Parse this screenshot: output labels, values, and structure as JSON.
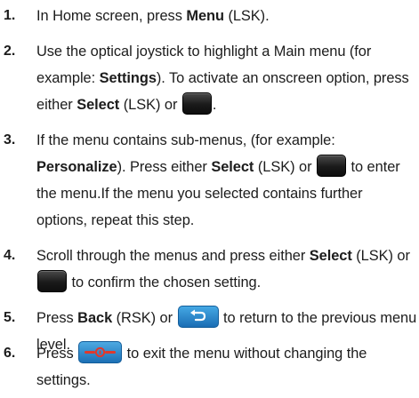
{
  "steps": [
    {
      "number": "1.",
      "lines": [
        {
          "t1": "In Home screen, press ",
          "b1": "Menu",
          "t2": " (LSK)."
        }
      ]
    },
    {
      "number": "2.",
      "lines": [
        {
          "t1": "Use the optical joystick to highlight a Main menu (for"
        },
        {
          "t1": "example: ",
          "b1": "Settings",
          "t2": "). To activate an onscreen option, press"
        },
        {
          "t1": "either ",
          "b1": "Select",
          "t2": " (LSK) or ",
          "key": "ok-key-dark",
          "t3": "."
        }
      ]
    },
    {
      "number": "3.",
      "lines": [
        {
          "t1": "If the menu contains sub-menus, (for example:"
        },
        {
          "b1": "Personalize",
          "t1": "). Press either ",
          "b2": "Select",
          "t2": " (LSK) or ",
          "key": "ok-key-dark",
          "t3": " to enter"
        },
        {
          "t1": "the menu.If the menu you selected contains further"
        },
        {
          "t1": "options, repeat this step."
        }
      ]
    },
    {
      "number": "4.",
      "lines": [
        {
          "t1": "Scroll through the menus and press either ",
          "b1": "Select",
          "t2": " (LSK) or"
        },
        {
          "key": "ok-key-dark",
          "t1": " to confirm the chosen setting."
        }
      ]
    },
    {
      "number": "5.",
      "lines": [
        {
          "t1": "Press ",
          "b1": "Back",
          "t2": " (RSK) or ",
          "key": "back-key-blue",
          "t3": " to return to the previous menu"
        },
        {
          "t1": "level."
        }
      ]
    },
    {
      "number": "6.",
      "lines": [
        {
          "t1": "Press ",
          "key": "end-key-blue",
          "t2": " to exit the menu without changing the"
        },
        {
          "t1": "settings."
        }
      ]
    }
  ],
  "colors": {
    "text": "#1c1c1c",
    "key_dark": "#151515",
    "key_blue": "#2a87cf",
    "end_icon_red": "#e0382c"
  }
}
